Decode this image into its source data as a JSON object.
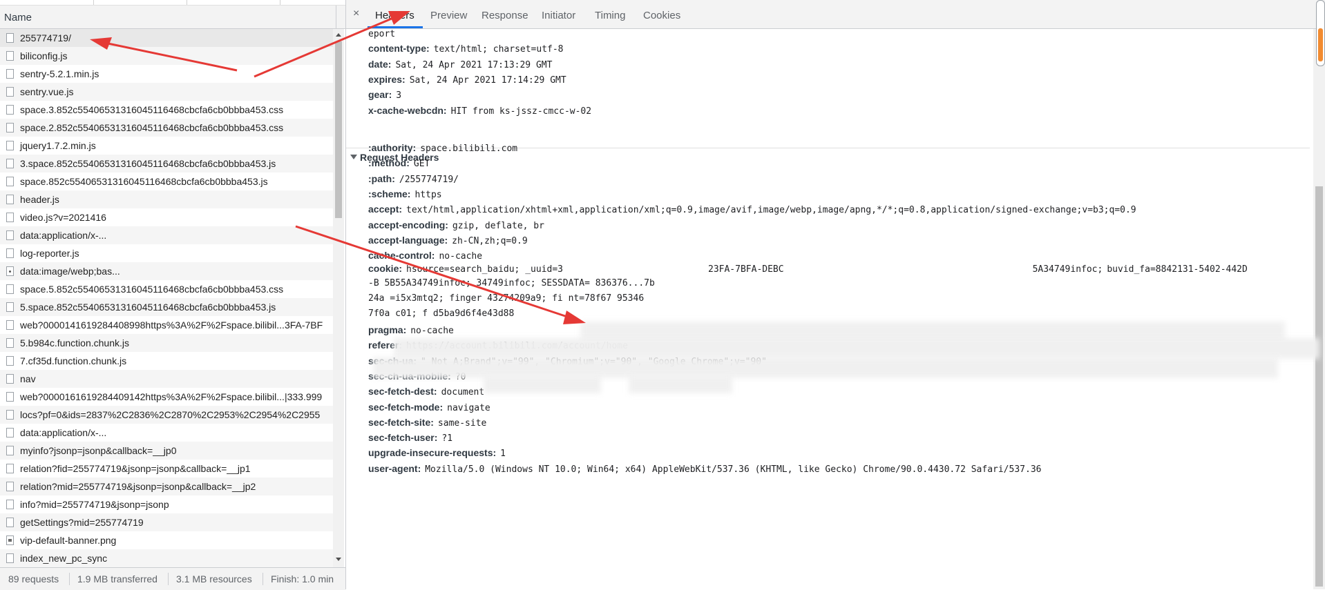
{
  "left_panel": {
    "column_header": "Name",
    "requests": [
      {
        "name": "255774719/",
        "icon": "document-icon",
        "selected": true
      },
      {
        "name": "biliconfig.js",
        "icon": "document-icon"
      },
      {
        "name": "sentry-5.2.1.min.js",
        "icon": "document-icon"
      },
      {
        "name": "sentry.vue.js",
        "icon": "document-icon"
      },
      {
        "name": "space.3.852c5540653131604511646​8cbcfa6cb0bbba453.css",
        "icon": "document-icon"
      },
      {
        "name": "space.2.852c5540653131604511646​8cbcfa6cb0bbba453.css",
        "icon": "document-icon"
      },
      {
        "name": "jquery1.7.2.min.js",
        "icon": "document-icon"
      },
      {
        "name": "3.space.852c5540653131604511646​8cbcfa6cb0bbba453.js",
        "icon": "document-icon"
      },
      {
        "name": "space.852c5540653131604511646​8cbcfa6cb0bbba453.js",
        "icon": "document-icon"
      },
      {
        "name": "header.js",
        "icon": "document-icon"
      },
      {
        "name": "video.js?v=2021416",
        "icon": "document-icon"
      },
      {
        "name": "data:application/x-...",
        "icon": "document-icon"
      },
      {
        "name": "log-reporter.js",
        "icon": "document-icon"
      },
      {
        "name": "data:image/webp;bas...",
        "icon": "dot-icon"
      },
      {
        "name": "space.5.852c5540653131604511646​8cbcfa6cb0bbba453.css",
        "icon": "document-icon"
      },
      {
        "name": "5.space.852c5540653131604511646​8cbcfa6cb0bbba453.js",
        "icon": "document-icon"
      },
      {
        "name": "web?000014161928​4408998https%3A%2F%2Fspace.bilibil...3FA-7BF",
        "icon": "document-icon"
      },
      {
        "name": "5.b984c.function.chunk.js",
        "icon": "document-icon"
      },
      {
        "name": "7.cf35d.function.chunk.js",
        "icon": "document-icon"
      },
      {
        "name": "nav",
        "icon": "document-icon"
      },
      {
        "name": "web?000016161928​4409142https%3A%2F%2Fspace.bilibil...|333.999",
        "icon": "document-icon"
      },
      {
        "name": "locs?pf=0&ids=2837%2C2836%2C2870%2C2953%2C2954%2C2955",
        "icon": "document-icon"
      },
      {
        "name": "data:application/x-...",
        "icon": "document-icon"
      },
      {
        "name": "myinfo?jsonp=jsonp&callback=__jp0",
        "icon": "document-icon"
      },
      {
        "name": "relation?fid=255774719&jsonp=jsonp&callback=__jp1",
        "icon": "document-icon"
      },
      {
        "name": "relation?mid=255774719&jsonp=jsonp&callback=__jp2",
        "icon": "document-icon"
      },
      {
        "name": "info?mid=255774719&jsonp=jsonp",
        "icon": "document-icon"
      },
      {
        "name": "getSettings?mid=255774719",
        "icon": "document-icon"
      },
      {
        "name": "vip-default-banner.png",
        "icon": "image-icon"
      },
      {
        "name": "index_new_pc_sync",
        "icon": "document-icon"
      }
    ],
    "status": {
      "requests": "89 requests",
      "transferred": "1.9 MB transferred",
      "resources": "3.1 MB resources",
      "finish": "Finish: 1.0 min"
    }
  },
  "right_panel": {
    "close_glyph": "×",
    "tabs": [
      "Headers",
      "Preview",
      "Response",
      "Initiator",
      "Timing",
      "Cookies"
    ],
    "active_tab": "Headers",
    "response_headers_tail": [
      {
        "name": "",
        "value": "eport"
      },
      {
        "name": "content-type:",
        "value": "text/html; charset=utf-8"
      },
      {
        "name": "date:",
        "value": "Sat, 24 Apr 2021 17:13:29 GMT"
      },
      {
        "name": "expires:",
        "value": "Sat, 24 Apr 2021 17:14:29 GMT"
      },
      {
        "name": "gear:",
        "value": "3"
      },
      {
        "name": "x-cache-webcdn:",
        "value": "HIT from ks-jssz-cmcc-w-02"
      }
    ],
    "request_headers_title": "Request Headers",
    "request_headers": [
      {
        "name": ":authority:",
        "value": "space.bilibili.com"
      },
      {
        "name": ":method:",
        "value": "GET"
      },
      {
        "name": ":path:",
        "value": "/255774719/"
      },
      {
        "name": ":scheme:",
        "value": "https"
      },
      {
        "name": "accept:",
        "value": "text/html,application/xhtml+xml,application/xml;q=0.9,image/avif,image/webp,image/apng,*/*;q=0.8,application/signed-exchange;v=b3;q=0.9"
      },
      {
        "name": "accept-encoding:",
        "value": "gzip, deflate, br"
      },
      {
        "name": "accept-language:",
        "value": "zh-CN,zh;q=0.9"
      },
      {
        "name": "cache-control:",
        "value": "no-cache"
      }
    ],
    "cookie": {
      "name": "cookie:",
      "lines": [
        "buvid_fa=8842131-5402-442D",
        "-B                  5B55A34749infoc;              34749infoc; SESSDATA=              836376...7b",
        "24a                                                   =i5x3mtq2; finger             43274209a9; fi          nt=78f67        95346",
        "7f0a        c01;  f            d5ba9d6f4e43d88"
      ],
      "first_line_prefix": "hsource=search_baidu; _uuid=3",
      "first_line_mid": "23FA-7BFA-DEBC",
      "first_line_tail": "5A34749infoc;"
    },
    "request_headers_after": [
      {
        "name": "pragma:",
        "value": "no-cache"
      },
      {
        "name": "referer:",
        "value": "https://account.bilibili.com/account/home"
      },
      {
        "name": "sec-ch-ua:",
        "value": "\" Not A;Brand\";v=\"99\", \"Chromium\";v=\"90\", \"Google Chrome\";v=\"90\""
      },
      {
        "name": "sec-ch-ua-mobile:",
        "value": "?0"
      },
      {
        "name": "sec-fetch-dest:",
        "value": "document"
      },
      {
        "name": "sec-fetch-mode:",
        "value": "navigate"
      },
      {
        "name": "sec-fetch-site:",
        "value": "same-site"
      },
      {
        "name": "sec-fetch-user:",
        "value": "?1"
      },
      {
        "name": "upgrade-insecure-requests:",
        "value": "1"
      },
      {
        "name": "user-agent:",
        "value": "Mozilla/5.0 (Windows NT 10.0; Win64; x64) AppleWebKit/537.36 (KHTML, like Gecko) Chrome/90.0.4430.72 Safari/537.36"
      }
    ]
  },
  "colors": {
    "accent": "#1a73e8",
    "annotation_arrow": "#e53935",
    "scroll_marker": "#f28b30"
  }
}
